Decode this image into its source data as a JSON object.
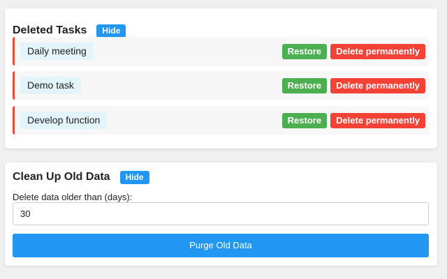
{
  "deleted_tasks": {
    "title": "Deleted Tasks",
    "hide_label": "Hide",
    "restore_label": "Restore",
    "delete_label": "Delete permanently",
    "items": [
      {
        "name": "Daily meeting"
      },
      {
        "name": "Demo task"
      },
      {
        "name": "Develop function"
      }
    ]
  },
  "cleanup": {
    "title": "Clean Up Old Data",
    "hide_label": "Hide",
    "days_label": "Delete data older than (days):",
    "days_value": "30",
    "purge_label": "Purge Old Data"
  },
  "colors": {
    "primary": "#2196f3",
    "restore": "#4caf50",
    "delete": "#f44336",
    "row_accent": "#e74c3c",
    "task_label_bg": "#e3f4fa"
  }
}
